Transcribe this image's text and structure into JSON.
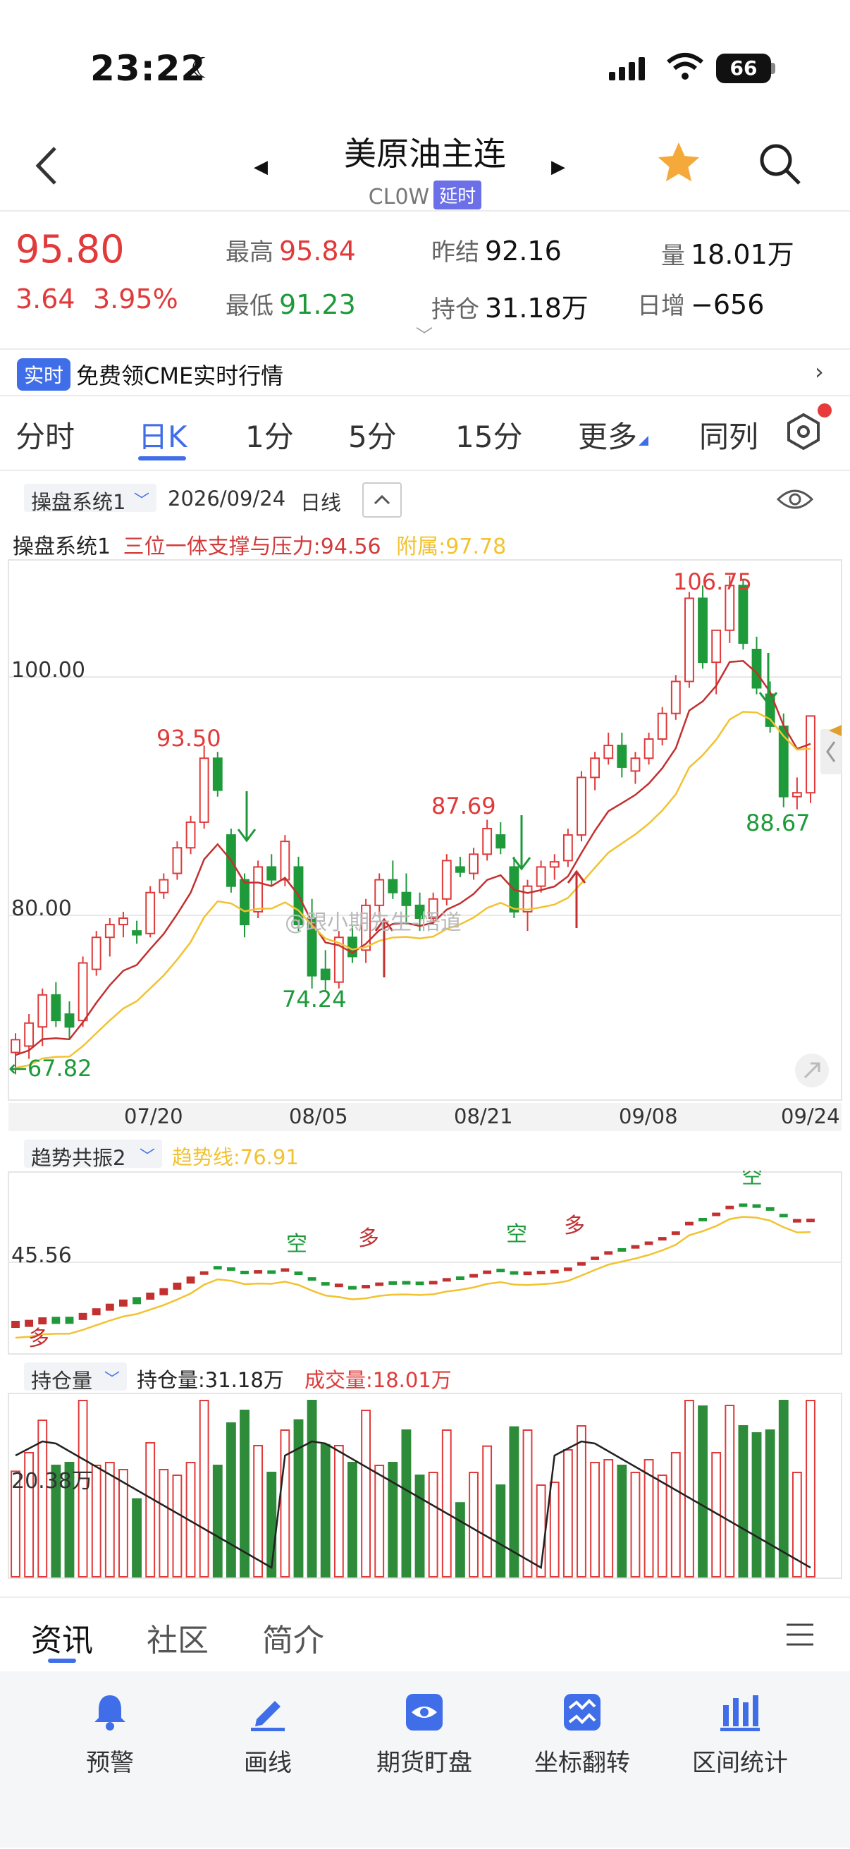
{
  "status_bar": {
    "time": "23:22",
    "battery": "66"
  },
  "header": {
    "title": "美原油主连",
    "code": "CL0W",
    "delay_badge": "延时"
  },
  "quote": {
    "price": "95.80",
    "change": "3.64",
    "change_pct": "3.95%",
    "high_label": "最高",
    "high": "95.84",
    "low_label": "最低",
    "low": "91.23",
    "prev_settle_label": "昨结",
    "prev_settle": "92.16",
    "open_interest_label": "持仓",
    "open_interest": "31.18万",
    "volume_label": "量",
    "volume": "18.01万",
    "daily_inc_label": "日增",
    "daily_inc": "−656"
  },
  "banner": {
    "badge": "实时",
    "text": "免费领CME实时行情"
  },
  "tabs": [
    "分时",
    "日K",
    "1分",
    "5分",
    "15分",
    "更多",
    "同列"
  ],
  "chart_header": {
    "system": "操盘系统1",
    "date": "2026/09/24",
    "period": "日线"
  },
  "indicator": {
    "name": "操盘系统1",
    "support": "三位一体支撑与压力:94.56",
    "aux": "附属:97.78"
  },
  "sub1": {
    "name": "趋势共振2",
    "trend": "趋势线:76.91",
    "level": "45.56"
  },
  "sub2": {
    "name": "持仓量",
    "oi": "持仓量:31.18万",
    "vol": "成交量:18.01万",
    "level": "20.38万"
  },
  "watermark": "@跟小期先生-悟道",
  "bottom_tabs": [
    "资讯",
    "社区",
    "简介"
  ],
  "toolbar": [
    "预警",
    "画线",
    "期货盯盘",
    "坐标翻转",
    "区间统计"
  ],
  "colors": {
    "up": "#e03a3a",
    "down": "#1e9a3a",
    "accent": "#3f6ee8",
    "line_yellow": "#f2c230"
  },
  "chart_data": {
    "type": "candlestick",
    "y_labels": [
      "100.00",
      "80.00"
    ],
    "x_labels": [
      "07/20",
      "08/05",
      "08/21",
      "09/08",
      "09/24"
    ],
    "annotations": [
      "106.75",
      "93.50",
      "87.69",
      "74.24",
      "88.67",
      "67.82"
    ],
    "ylim": [
      66,
      108
    ],
    "candles": [
      {
        "o": 69.5,
        "h": 71,
        "l": 67.8,
        "c": 70.5
      },
      {
        "o": 70,
        "h": 72.5,
        "l": 69,
        "c": 71.8
      },
      {
        "o": 71.5,
        "h": 74.5,
        "l": 70,
        "c": 74
      },
      {
        "o": 74,
        "h": 75,
        "l": 71.5,
        "c": 72
      },
      {
        "o": 72.5,
        "h": 73.5,
        "l": 70.5,
        "c": 71.5
      },
      {
        "o": 72,
        "h": 77,
        "l": 71.5,
        "c": 76.5
      },
      {
        "o": 76,
        "h": 79,
        "l": 75.5,
        "c": 78.5
      },
      {
        "o": 78.5,
        "h": 80,
        "l": 77,
        "c": 79.5
      },
      {
        "o": 79.5,
        "h": 80.5,
        "l": 78.5,
        "c": 80
      },
      {
        "o": 79,
        "h": 79.8,
        "l": 78,
        "c": 78.7
      },
      {
        "o": 78.8,
        "h": 82.5,
        "l": 78.5,
        "c": 82
      },
      {
        "o": 82,
        "h": 83.5,
        "l": 81.5,
        "c": 83
      },
      {
        "o": 83.5,
        "h": 86,
        "l": 83,
        "c": 85.5
      },
      {
        "o": 85.5,
        "h": 88,
        "l": 85,
        "c": 87.5
      },
      {
        "o": 87.5,
        "h": 93.5,
        "l": 87,
        "c": 92.5
      },
      {
        "o": 92.5,
        "h": 93,
        "l": 89.5,
        "c": 90
      },
      {
        "o": 86.5,
        "h": 87,
        "l": 82,
        "c": 82.5
      },
      {
        "o": 83,
        "h": 83.5,
        "l": 78.5,
        "c": 79.5
      },
      {
        "o": 80.5,
        "h": 84.5,
        "l": 80,
        "c": 84
      },
      {
        "o": 84,
        "h": 85,
        "l": 82.5,
        "c": 83
      },
      {
        "o": 83,
        "h": 86.5,
        "l": 82.5,
        "c": 86
      },
      {
        "o": 84,
        "h": 84.8,
        "l": 79,
        "c": 79.5
      },
      {
        "o": 80,
        "h": 81.5,
        "l": 74.5,
        "c": 75.5
      },
      {
        "o": 76,
        "h": 77.5,
        "l": 74.24,
        "c": 75.2
      },
      {
        "o": 75,
        "h": 79,
        "l": 74.5,
        "c": 78.5
      },
      {
        "o": 78.5,
        "h": 79.5,
        "l": 76.5,
        "c": 77
      },
      {
        "o": 77.5,
        "h": 81.5,
        "l": 76.5,
        "c": 81
      },
      {
        "o": 81,
        "h": 83.5,
        "l": 80,
        "c": 83
      },
      {
        "o": 83,
        "h": 84.5,
        "l": 81.5,
        "c": 82
      },
      {
        "o": 82,
        "h": 83.5,
        "l": 79.5,
        "c": 81
      },
      {
        "o": 81,
        "h": 82,
        "l": 79,
        "c": 80
      },
      {
        "o": 80,
        "h": 82,
        "l": 79.5,
        "c": 81.5
      },
      {
        "o": 81.5,
        "h": 85,
        "l": 81,
        "c": 84.5
      },
      {
        "o": 84,
        "h": 84.8,
        "l": 83.2,
        "c": 83.6
      },
      {
        "o": 83.5,
        "h": 85.5,
        "l": 83,
        "c": 85
      },
      {
        "o": 85,
        "h": 87.69,
        "l": 84.5,
        "c": 87
      },
      {
        "o": 86.5,
        "h": 87.5,
        "l": 85,
        "c": 85.5
      },
      {
        "o": 84,
        "h": 84.8,
        "l": 80,
        "c": 80.5
      },
      {
        "o": 80.5,
        "h": 83,
        "l": 79,
        "c": 82.5
      },
      {
        "o": 82.5,
        "h": 84.5,
        "l": 82,
        "c": 84
      },
      {
        "o": 84,
        "h": 85,
        "l": 83,
        "c": 84.4
      },
      {
        "o": 84.5,
        "h": 87,
        "l": 84,
        "c": 86.5
      },
      {
        "o": 86.5,
        "h": 91.5,
        "l": 86,
        "c": 91
      },
      {
        "o": 91,
        "h": 93,
        "l": 90,
        "c": 92.5
      },
      {
        "o": 92.5,
        "h": 94.5,
        "l": 92,
        "c": 93.5
      },
      {
        "o": 93.5,
        "h": 94.5,
        "l": 91,
        "c": 91.8
      },
      {
        "o": 91.5,
        "h": 93,
        "l": 90.5,
        "c": 92.5
      },
      {
        "o": 92.5,
        "h": 94.5,
        "l": 92,
        "c": 94
      },
      {
        "o": 94,
        "h": 96.5,
        "l": 93.5,
        "c": 96
      },
      {
        "o": 96,
        "h": 99,
        "l": 95.5,
        "c": 98.5
      },
      {
        "o": 98.5,
        "h": 105.5,
        "l": 98,
        "c": 105
      },
      {
        "o": 105,
        "h": 106,
        "l": 99.5,
        "c": 100
      },
      {
        "o": 100,
        "h": 101,
        "l": 97.5,
        "c": 102.5
      },
      {
        "o": 102.5,
        "h": 106.75,
        "l": 101.5,
        "c": 106
      },
      {
        "o": 106,
        "h": 106.5,
        "l": 101,
        "c": 101.5
      },
      {
        "o": 101,
        "h": 102,
        "l": 97.5,
        "c": 98
      },
      {
        "o": 97.5,
        "h": 98.5,
        "l": 94.5,
        "c": 95
      },
      {
        "o": 95,
        "h": 96,
        "l": 88.67,
        "c": 89.5
      },
      {
        "o": 89.5,
        "h": 91,
        "l": 88.5,
        "c": 89.8
      },
      {
        "o": 89.8,
        "h": 95.84,
        "l": 89,
        "c": 95.8
      }
    ]
  }
}
